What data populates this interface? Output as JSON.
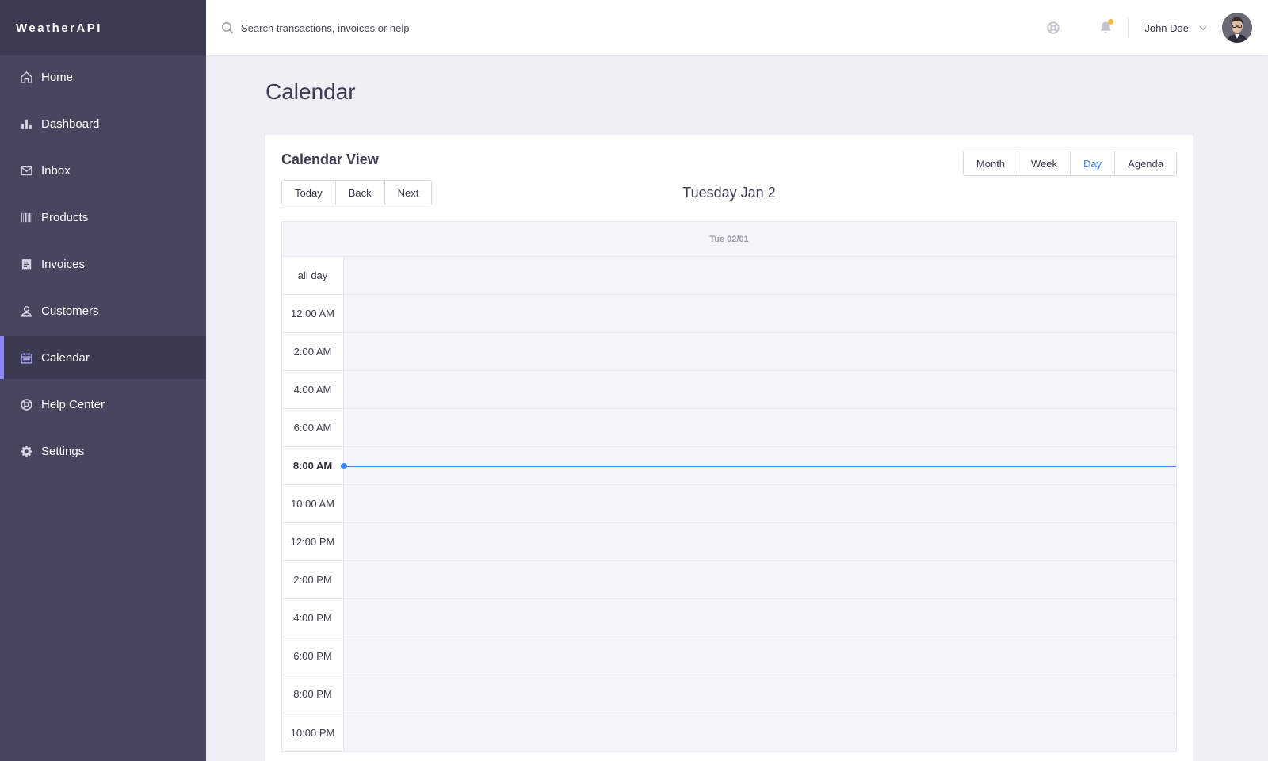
{
  "app": {
    "brand": "WeatherAPI"
  },
  "colors": {
    "sidebar": "#46465f",
    "active_indicator": "#8b87f2",
    "accent": "#3d8af2",
    "notification": "#f7b63c"
  },
  "sidebar": {
    "items": [
      {
        "label": "Home",
        "icon": "home-icon",
        "active": false
      },
      {
        "label": "Dashboard",
        "icon": "bar-chart-icon",
        "active": false
      },
      {
        "label": "Inbox",
        "icon": "mail-icon",
        "active": false
      },
      {
        "label": "Products",
        "icon": "barcode-icon",
        "active": false
      },
      {
        "label": "Invoices",
        "icon": "receipt-icon",
        "active": false
      },
      {
        "label": "Customers",
        "icon": "user-icon",
        "active": false
      },
      {
        "label": "Calendar",
        "icon": "calendar-icon",
        "active": true
      },
      {
        "label": "Help Center",
        "icon": "lifebuoy-icon",
        "active": false
      },
      {
        "label": "Settings",
        "icon": "gear-icon",
        "active": false
      }
    ]
  },
  "topbar": {
    "search_placeholder": "Search transactions, invoices or help",
    "user_name": "John Doe",
    "has_notification": true
  },
  "page": {
    "title": "Calendar"
  },
  "calendar": {
    "card_title": "Calendar View",
    "nav_buttons": {
      "today": "Today",
      "back": "Back",
      "next": "Next"
    },
    "views": {
      "month": "Month",
      "week": "Week",
      "day": "Day",
      "agenda": "Agenda"
    },
    "selected_view": "Day",
    "date_label": "Tuesday Jan 2",
    "day_header": "Tue 02/01",
    "all_day_label": "all day",
    "time_slots": [
      "12:00 AM",
      "2:00 AM",
      "4:00 AM",
      "6:00 AM",
      "8:00 AM",
      "10:00 AM",
      "12:00 PM",
      "2:00 PM",
      "4:00 PM",
      "6:00 PM",
      "8:00 PM",
      "10:00 PM"
    ],
    "current_time_slot": "8:00 AM"
  }
}
